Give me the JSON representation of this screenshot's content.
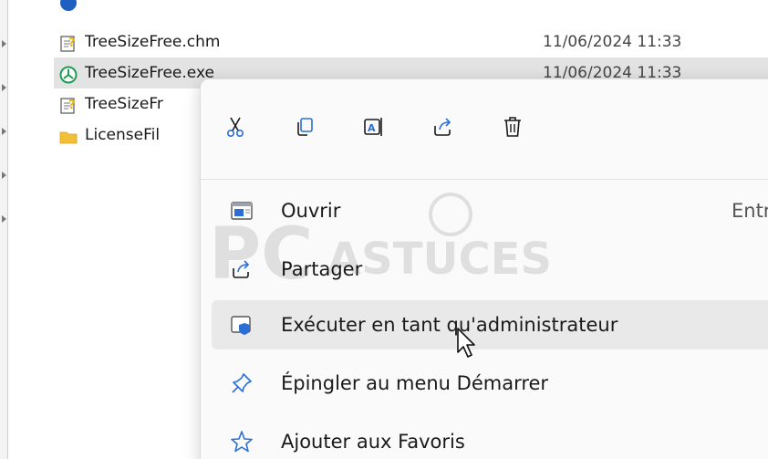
{
  "files": [
    {
      "name": "TreeSizeFree.chm",
      "date": "11/06/2024 11:33",
      "icon": "help-file-icon"
    },
    {
      "name": "TreeSizeFree.exe",
      "date": "11/06/2024 11:33",
      "icon": "treesize-app-icon"
    },
    {
      "name": "TreeSizeFr",
      "date": "",
      "icon": "help-file-icon"
    },
    {
      "name": "LicenseFil",
      "date": "",
      "icon": "folder-icon"
    }
  ],
  "context_menu": {
    "toolbar": [
      {
        "name": "cut",
        "icon": "scissors-icon"
      },
      {
        "name": "copy",
        "icon": "copy-icon"
      },
      {
        "name": "rename",
        "icon": "rename-icon"
      },
      {
        "name": "share",
        "icon": "share-icon"
      },
      {
        "name": "delete",
        "icon": "trash-icon"
      }
    ],
    "items": [
      {
        "label": "Ouvrir",
        "shortcut": "Entre",
        "icon": "open-window-icon"
      },
      {
        "label": "Partager",
        "icon": "share-icon"
      },
      {
        "label": "Exécuter en tant qu'administrateur",
        "icon": "shield-window-icon",
        "hovered": true
      },
      {
        "label": "Épingler au menu Démarrer",
        "icon": "pin-icon"
      },
      {
        "label": "Ajouter aux Favoris",
        "icon": "star-icon"
      }
    ]
  },
  "watermark": "PC ASTUCES",
  "colors": {
    "accent": "#2b6fd6",
    "selected_row": "#e3e3e3",
    "hover_item": "#e9e9e9",
    "app_green": "#1f9d55",
    "folder_yellow": "#f2c038"
  }
}
